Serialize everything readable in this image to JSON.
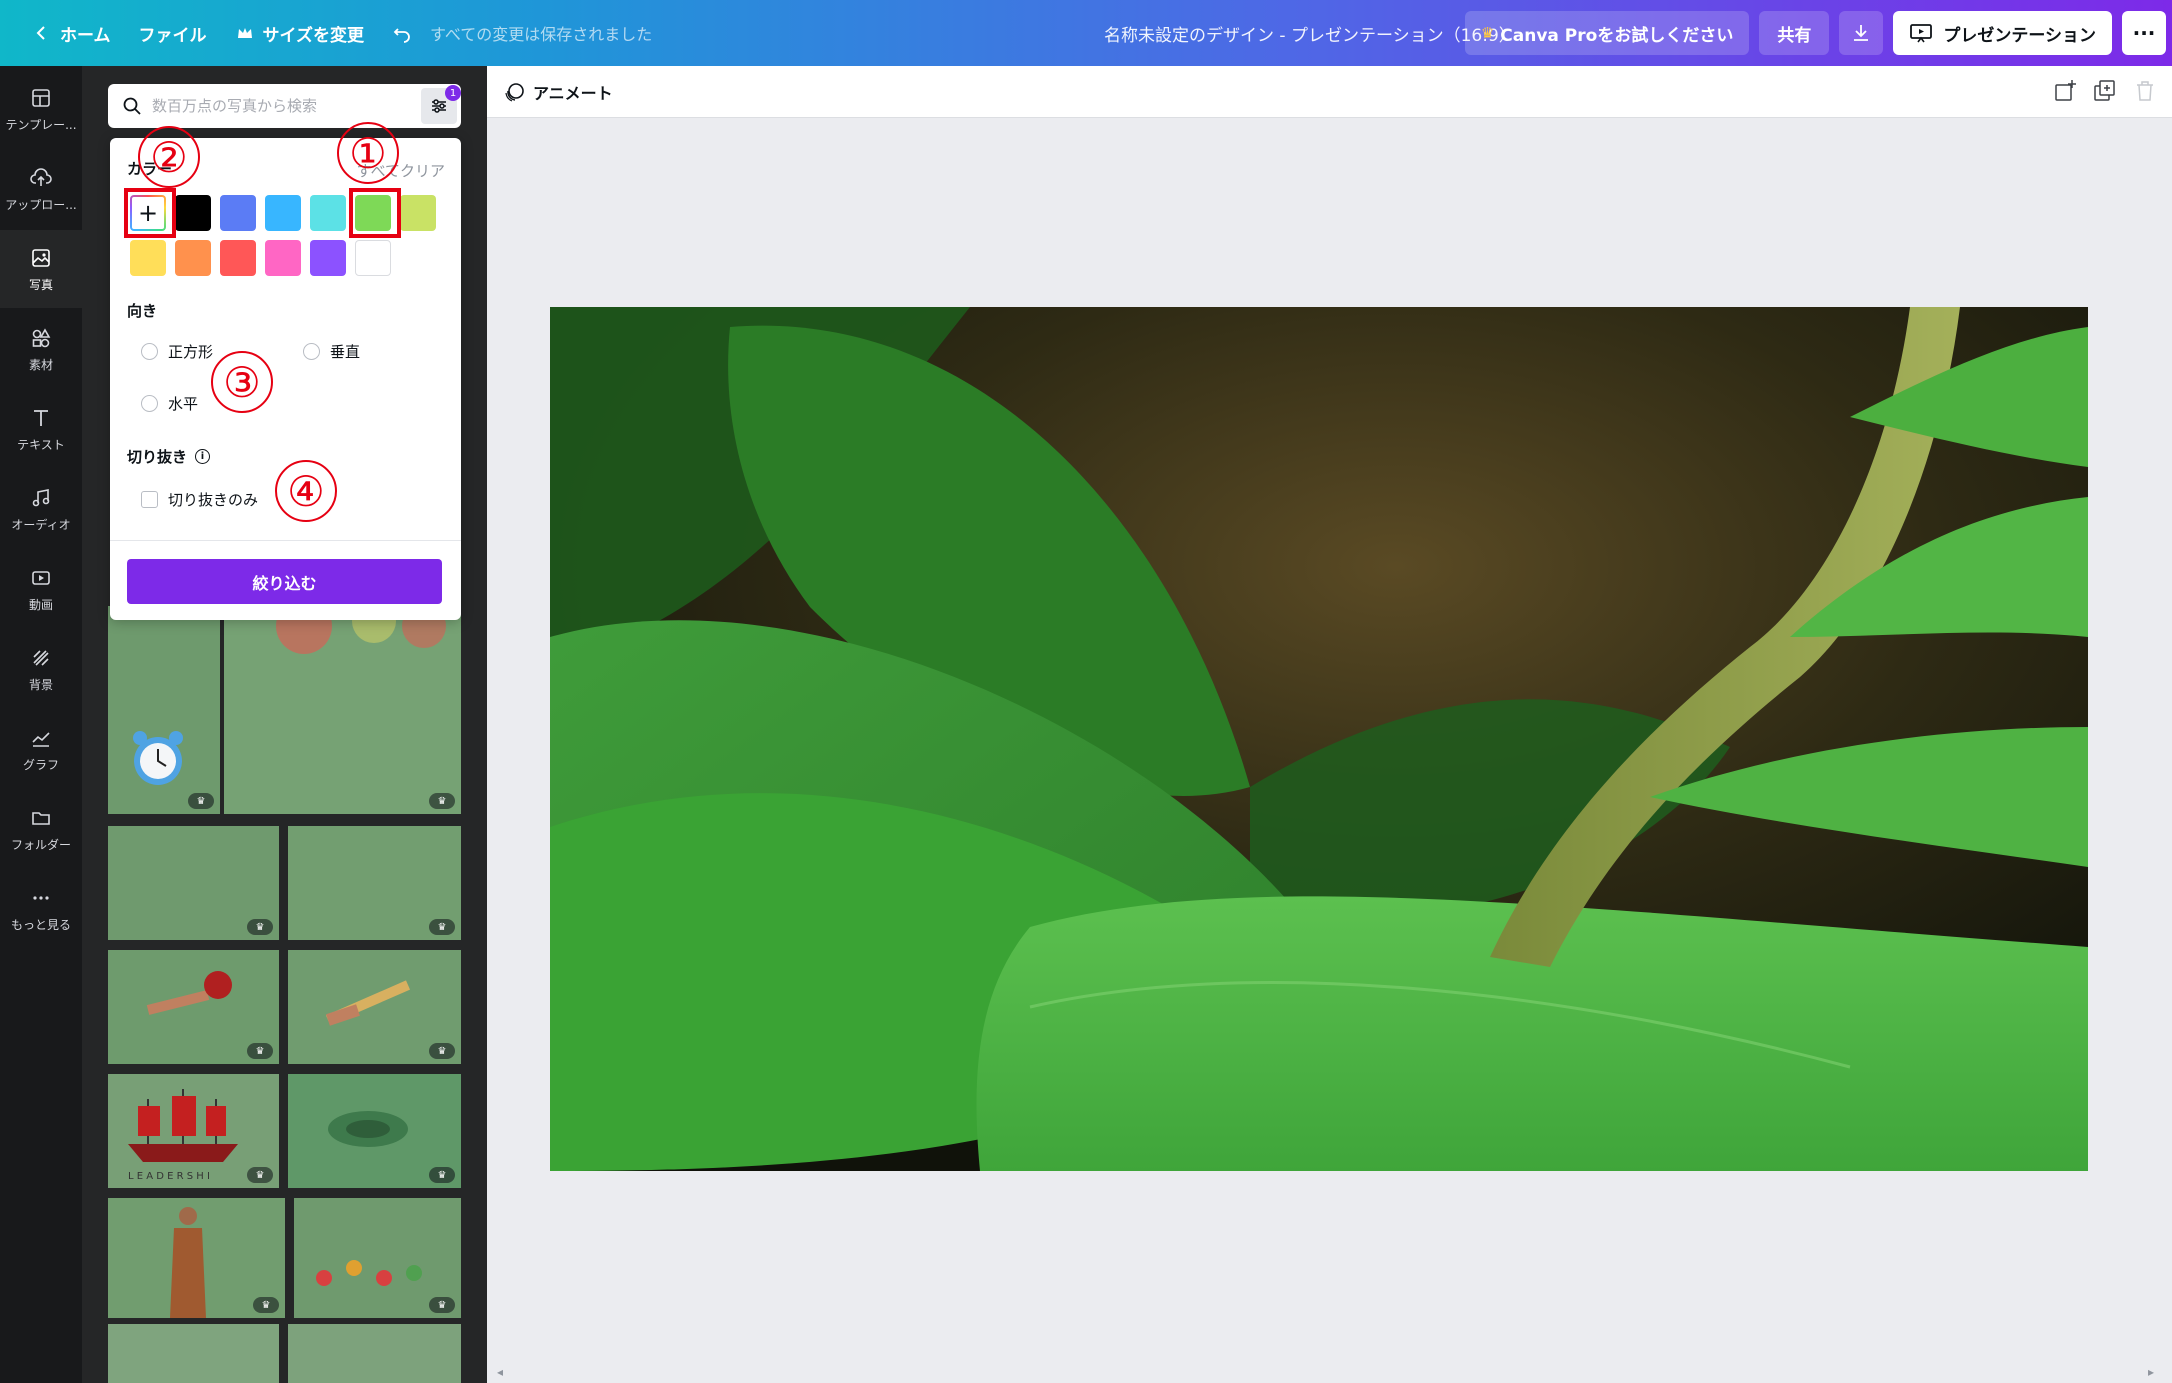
{
  "topbar": {
    "home": "ホーム",
    "file": "ファイル",
    "resize": "サイズを変更",
    "saved_status": "すべての変更は保存されました",
    "title": "名称未設定のデザイン - プレゼンテーション（16:9）",
    "try_pro": "Canva Proをお試しください",
    "share": "共有",
    "present": "プレゼンテーション"
  },
  "rail": [
    {
      "label": "テンプレー...",
      "icon": "template-icon"
    },
    {
      "label": "アップロー...",
      "icon": "upload-icon"
    },
    {
      "label": "写真",
      "icon": "photo-icon"
    },
    {
      "label": "素材",
      "icon": "elements-icon"
    },
    {
      "label": "テキスト",
      "icon": "text-icon"
    },
    {
      "label": "オーディオ",
      "icon": "audio-icon"
    },
    {
      "label": "動画",
      "icon": "video-icon"
    },
    {
      "label": "背景",
      "icon": "background-icon"
    },
    {
      "label": "グラフ",
      "icon": "chart-icon"
    },
    {
      "label": "フォルダー",
      "icon": "folder-icon"
    },
    {
      "label": "もっと見る",
      "icon": "more-icon"
    }
  ],
  "search": {
    "placeholder": "数百万点の写真から検索",
    "filter_count": "1"
  },
  "filter": {
    "color_title": "カラー",
    "clear_all": "すべてクリア",
    "colors": [
      "#000000",
      "#5b7cf5",
      "#38b6ff",
      "#5ce1e6",
      "#7ed957",
      "#c9e265",
      "#ffde59",
      "#ff914d",
      "#ff5757",
      "#ff66c4",
      "#8c52ff",
      "#ffffff"
    ],
    "orientation_title": "向き",
    "square": "正方形",
    "vertical": "垂直",
    "horizontal": "水平",
    "cutout_title": "切り抜き",
    "cutout_only": "切り抜きのみ",
    "apply": "絞り込む"
  },
  "annotations": {
    "one": "①",
    "two": "②",
    "three": "③",
    "four": "④"
  },
  "workspace": {
    "animate": "アニメート"
  }
}
